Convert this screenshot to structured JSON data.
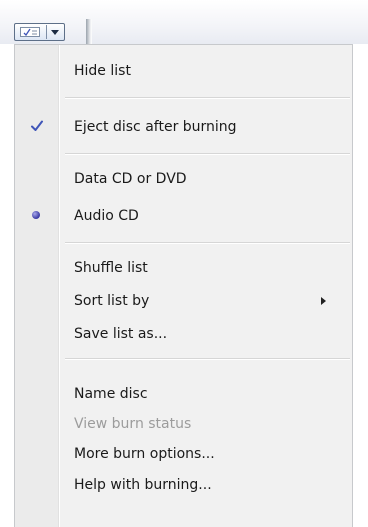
{
  "toolbar": {
    "menu_button_icon": "list-options-icon",
    "dropdown_icon": "chevron-down-icon"
  },
  "menu": {
    "items": [
      {
        "label": "Hide list"
      },
      {
        "label": "Eject disc after burning",
        "checked": true,
        "icon": "check-icon"
      },
      {
        "label": "Data CD or DVD"
      },
      {
        "label": "Audio CD",
        "selected": true,
        "icon": "radio-dot-icon"
      },
      {
        "label": "Shuffle list"
      },
      {
        "label": "Sort list by",
        "submenu": true,
        "icon": "submenu-arrow-icon"
      },
      {
        "label": "Save list as..."
      },
      {
        "label": "Name disc"
      },
      {
        "label": "View burn status",
        "disabled": true
      },
      {
        "label": "More burn options..."
      },
      {
        "label": "Help with burning..."
      }
    ]
  },
  "colors": {
    "check": "#3f55b8",
    "radio": "#3d3da6",
    "disabled_text": "#9c9c9c",
    "menu_background": "#f1f1f1"
  }
}
